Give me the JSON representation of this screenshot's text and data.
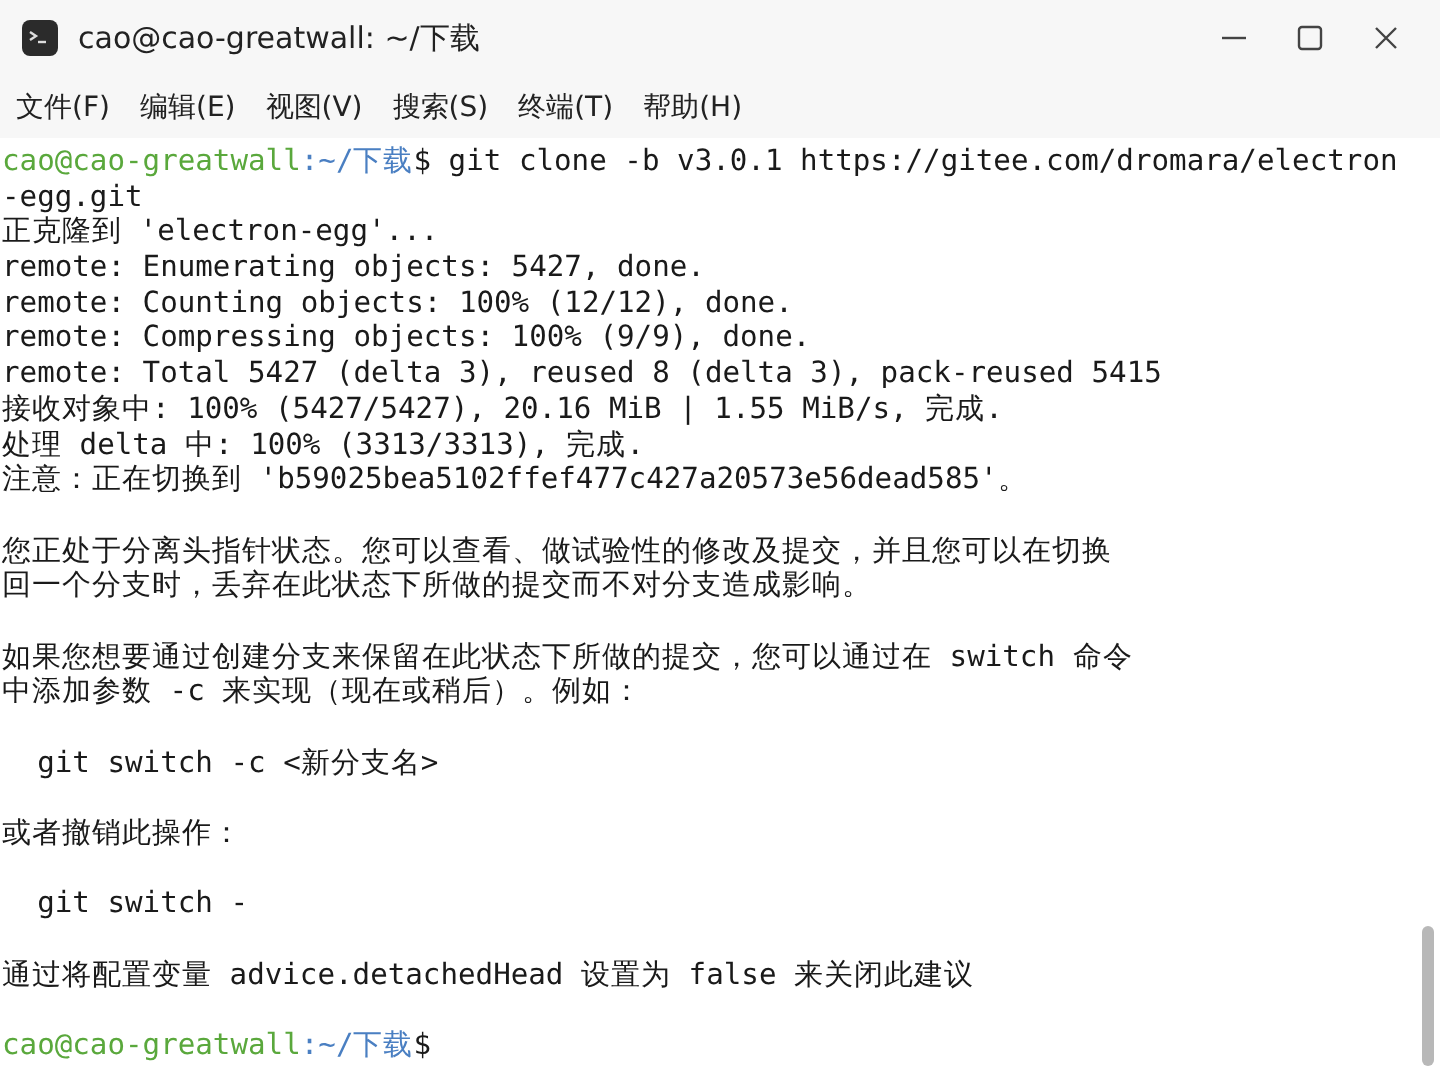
{
  "window": {
    "title": "cao@cao-greatwall: ~/下载"
  },
  "menu": [
    "文件(F)",
    "编辑(E)",
    "视图(V)",
    "搜索(S)",
    "终端(T)",
    "帮助(H)"
  ],
  "terminal": {
    "lines": [
      {
        "kind": "prompt",
        "user": "cao@cao-greatwall",
        "path": ":~/下载",
        "command": "$ git clone -b v3.0.1 https://gitee.com/dromara/electron"
      },
      {
        "kind": "output",
        "text": "-egg.git"
      },
      {
        "kind": "output",
        "text": "正克隆到 'electron-egg'..."
      },
      {
        "kind": "output",
        "text": "remote: Enumerating objects: 5427, done."
      },
      {
        "kind": "output",
        "text": "remote: Counting objects: 100% (12/12), done."
      },
      {
        "kind": "output",
        "text": "remote: Compressing objects: 100% (9/9), done."
      },
      {
        "kind": "output",
        "text": "remote: Total 5427 (delta 3), reused 8 (delta 3), pack-reused 5415"
      },
      {
        "kind": "output",
        "text": "接收对象中: 100% (5427/5427), 20.16 MiB | 1.55 MiB/s, 完成."
      },
      {
        "kind": "output",
        "text": "处理 delta 中: 100% (3313/3313), 完成."
      },
      {
        "kind": "output",
        "text": "注意：正在切换到 'b59025bea5102ffef477c427a20573e56dead585'。"
      },
      {
        "kind": "blank"
      },
      {
        "kind": "output",
        "text": "您正处于分离头指针状态。您可以查看、做试验性的修改及提交，并且您可以在切换"
      },
      {
        "kind": "output",
        "text": "回一个分支时，丢弃在此状态下所做的提交而不对分支造成影响。"
      },
      {
        "kind": "blank"
      },
      {
        "kind": "output",
        "text": "如果您想要通过创建分支来保留在此状态下所做的提交，您可以通过在 switch 命令"
      },
      {
        "kind": "output",
        "text": "中添加参数 -c 来实现（现在或稍后）。例如："
      },
      {
        "kind": "blank"
      },
      {
        "kind": "output",
        "text": "  git switch -c <新分支名>"
      },
      {
        "kind": "blank"
      },
      {
        "kind": "output",
        "text": "或者撤销此操作："
      },
      {
        "kind": "blank"
      },
      {
        "kind": "output",
        "text": "  git switch -"
      },
      {
        "kind": "blank"
      },
      {
        "kind": "output",
        "text": "通过将配置变量 advice.detachedHead 设置为 false 来关闭此建议"
      },
      {
        "kind": "blank"
      },
      {
        "kind": "prompt",
        "user": "cao@cao-greatwall",
        "path": ":~/下载",
        "command": "$"
      }
    ]
  }
}
